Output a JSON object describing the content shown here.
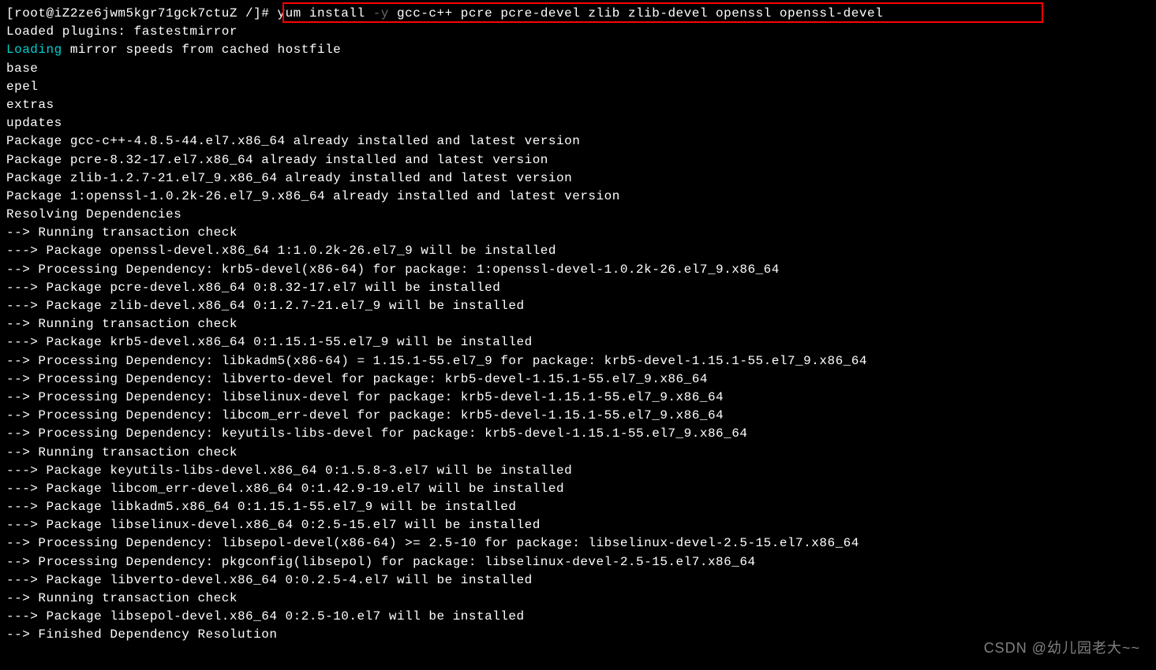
{
  "prompt": {
    "user_host": "[root@iZ2ze6jwm5kgr71gck7ctuZ ",
    "path": "/",
    "suffix": "]# ",
    "command_start": "yum install ",
    "flag": "-y",
    "command_rest": " gcc-c++ pcre pcre-devel zlib zlib-devel openssl openssl-devel"
  },
  "lines": {
    "l01": "Loaded plugins: fastestmirror",
    "l02a": "Loading",
    "l02b": " mirror speeds from cached hostfile",
    "l03": "base",
    "l04": "epel",
    "l05": "extras",
    "l06": "updates",
    "l07": "Package gcc-c++-4.8.5-44.el7.x86_64 already installed and latest version",
    "l08": "Package pcre-8.32-17.el7.x86_64 already installed and latest version",
    "l09": "Package zlib-1.2.7-21.el7_9.x86_64 already installed and latest version",
    "l10": "Package 1:openssl-1.0.2k-26.el7_9.x86_64 already installed and latest version",
    "l11": "Resolving Dependencies",
    "l12": "--> Running transaction check",
    "l13": "---> Package openssl-devel.x86_64 1:1.0.2k-26.el7_9 will be installed",
    "l14": "--> Processing Dependency: krb5-devel(x86-64) for package: 1:openssl-devel-1.0.2k-26.el7_9.x86_64",
    "l15": "---> Package pcre-devel.x86_64 0:8.32-17.el7 will be installed",
    "l16": "---> Package zlib-devel.x86_64 0:1.2.7-21.el7_9 will be installed",
    "l17": "--> Running transaction check",
    "l18": "---> Package krb5-devel.x86_64 0:1.15.1-55.el7_9 will be installed",
    "l19": "--> Processing Dependency: libkadm5(x86-64) = 1.15.1-55.el7_9 for package: krb5-devel-1.15.1-55.el7_9.x86_64",
    "l20": "--> Processing Dependency: libverto-devel for package: krb5-devel-1.15.1-55.el7_9.x86_64",
    "l21": "--> Processing Dependency: libselinux-devel for package: krb5-devel-1.15.1-55.el7_9.x86_64",
    "l22": "--> Processing Dependency: libcom_err-devel for package: krb5-devel-1.15.1-55.el7_9.x86_64",
    "l23": "--> Processing Dependency: keyutils-libs-devel for package: krb5-devel-1.15.1-55.el7_9.x86_64",
    "l24": "--> Running transaction check",
    "l25": "---> Package keyutils-libs-devel.x86_64 0:1.5.8-3.el7 will be installed",
    "l26": "---> Package libcom_err-devel.x86_64 0:1.42.9-19.el7 will be installed",
    "l27": "---> Package libkadm5.x86_64 0:1.15.1-55.el7_9 will be installed",
    "l28": "---> Package libselinux-devel.x86_64 0:2.5-15.el7 will be installed",
    "l29": "--> Processing Dependency: libsepol-devel(x86-64) >= 2.5-10 for package: libselinux-devel-2.5-15.el7.x86_64",
    "l30": "--> Processing Dependency: pkgconfig(libsepol) for package: libselinux-devel-2.5-15.el7.x86_64",
    "l31": "---> Package libverto-devel.x86_64 0:0.2.5-4.el7 will be installed",
    "l32": "--> Running transaction check",
    "l33": "---> Package libsepol-devel.x86_64 0:2.5-10.el7 will be installed",
    "l34": "--> Finished Dependency Resolution"
  },
  "watermark": "CSDN @幼儿园老大~~"
}
